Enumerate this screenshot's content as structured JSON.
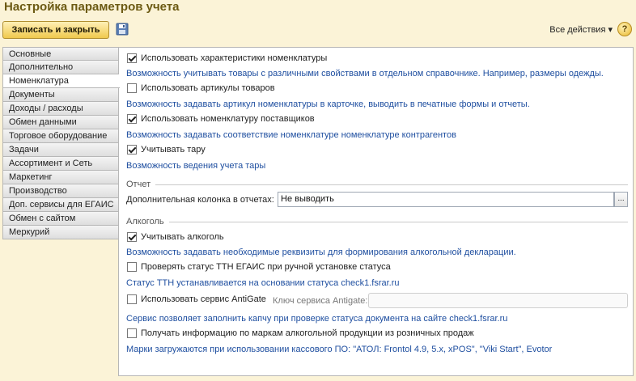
{
  "title": "Настройка параметров учета",
  "toolbar": {
    "save_close_label": "Записать и закрыть",
    "all_actions_label": "Все действия ▾",
    "help_label": "?"
  },
  "nav": {
    "items": [
      {
        "label": "Основные"
      },
      {
        "label": "Дополнительно"
      },
      {
        "label": "Номенклатура"
      },
      {
        "label": "Документы"
      },
      {
        "label": "Доходы / расходы"
      },
      {
        "label": "Обмен данными"
      },
      {
        "label": "Торговое оборудование"
      },
      {
        "label": "Задачи"
      },
      {
        "label": "Ассортимент и Сеть"
      },
      {
        "label": "Маркетинг"
      },
      {
        "label": "Производство"
      },
      {
        "label": "Доп. сервисы для ЕГАИС"
      },
      {
        "label": "Обмен с сайтом"
      },
      {
        "label": "Меркурий"
      }
    ],
    "active": "Номенклатура"
  },
  "options": {
    "characteristics": {
      "label": "Использовать характеристики номенклатуры",
      "checked": true,
      "hint": "Возможность учитывать товары с различными свойствами в отдельном справочнике. Например, размеры одежды."
    },
    "articles": {
      "label": "Использовать артикулы товаров",
      "checked": false,
      "hint": "Возможность задавать артикул номенклатуры в карточке, выводить в печатные формы и отчеты."
    },
    "supplier_items": {
      "label": "Использовать номенклатуру поставщиков",
      "checked": true,
      "hint": "Возможность задавать соответствие номенклатуре номенклатуре контрагентов"
    },
    "tare": {
      "label": "Учитывать тару",
      "checked": true,
      "hint": "Возможность ведения учета тары"
    }
  },
  "report": {
    "group_label": "Отчет",
    "extra_column_label": "Дополнительная колонка в отчетах:",
    "extra_column_value": "Не выводить",
    "select_button_label": "..."
  },
  "alcohol": {
    "group_label": "Алкоголь",
    "track": {
      "label": "Учитывать алкоголь",
      "checked": true,
      "hint": "Возможность задавать необходимые реквизиты для формирования алкогольной декларации."
    },
    "check_ttn": {
      "label": "Проверять статус ТТН ЕГАИС при ручной установке статуса",
      "checked": false,
      "hint": "Статус ТТН устанавливается на основании статуса check1.fsrar.ru"
    },
    "antigate": {
      "label": "Использовать сервис AntiGate",
      "checked": false,
      "key_label": "Ключ сервиса Antigate:",
      "key_value": "",
      "hint": "Сервис позволяет заполнить капчу при проверке статуса документа на сайте check1.fsrar.ru"
    },
    "marks": {
      "label": "Получать информацию по маркам алкогольной продукции из розничных продаж",
      "checked": false,
      "hint": "Марки загружаются при использовании кассового ПО: \"АТОЛ: Frontol 4.9, 5.x, xPOS\", \"Viki Start\", Evotor"
    }
  }
}
